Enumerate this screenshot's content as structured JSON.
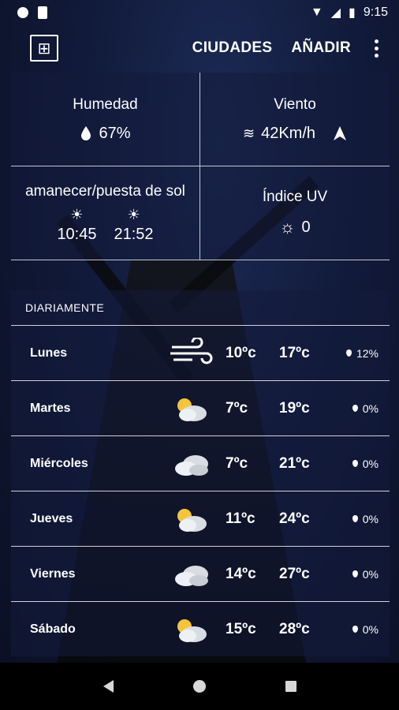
{
  "status_bar": {
    "time": "9:15"
  },
  "app_bar": {
    "cities_label": "CIUDADES",
    "add_label": "AÑADIR"
  },
  "conditions": {
    "humidity": {
      "label": "Humedad",
      "value": "67%"
    },
    "wind": {
      "label": "Viento",
      "value": "42Km/h"
    },
    "sun": {
      "label": "amanecer/puesta de sol",
      "sunrise": "10:45",
      "sunset": "21:52"
    },
    "uv": {
      "label": "Índice UV",
      "value": "0"
    }
  },
  "daily": {
    "header": "DIARIAMENTE",
    "days": [
      {
        "day": "Lunes",
        "icon": "wind-icon",
        "min": "10ºc",
        "max": "17ºc",
        "rain": "12%"
      },
      {
        "day": "Martes",
        "icon": "partly-cloudy-icon",
        "min": "7ºc",
        "max": "19ºc",
        "rain": "0%"
      },
      {
        "day": "Miércoles",
        "icon": "cloud-icon",
        "min": "7ºc",
        "max": "21ºc",
        "rain": "0%"
      },
      {
        "day": "Jueves",
        "icon": "partly-cloudy-icon",
        "min": "11ºc",
        "max": "24ºc",
        "rain": "0%"
      },
      {
        "day": "Viernes",
        "icon": "cloud-icon",
        "min": "14ºc",
        "max": "27ºc",
        "rain": "0%"
      },
      {
        "day": "Sábado",
        "icon": "partly-cloudy-icon",
        "min": "15ºc",
        "max": "28ºc",
        "rain": "0%"
      }
    ]
  }
}
